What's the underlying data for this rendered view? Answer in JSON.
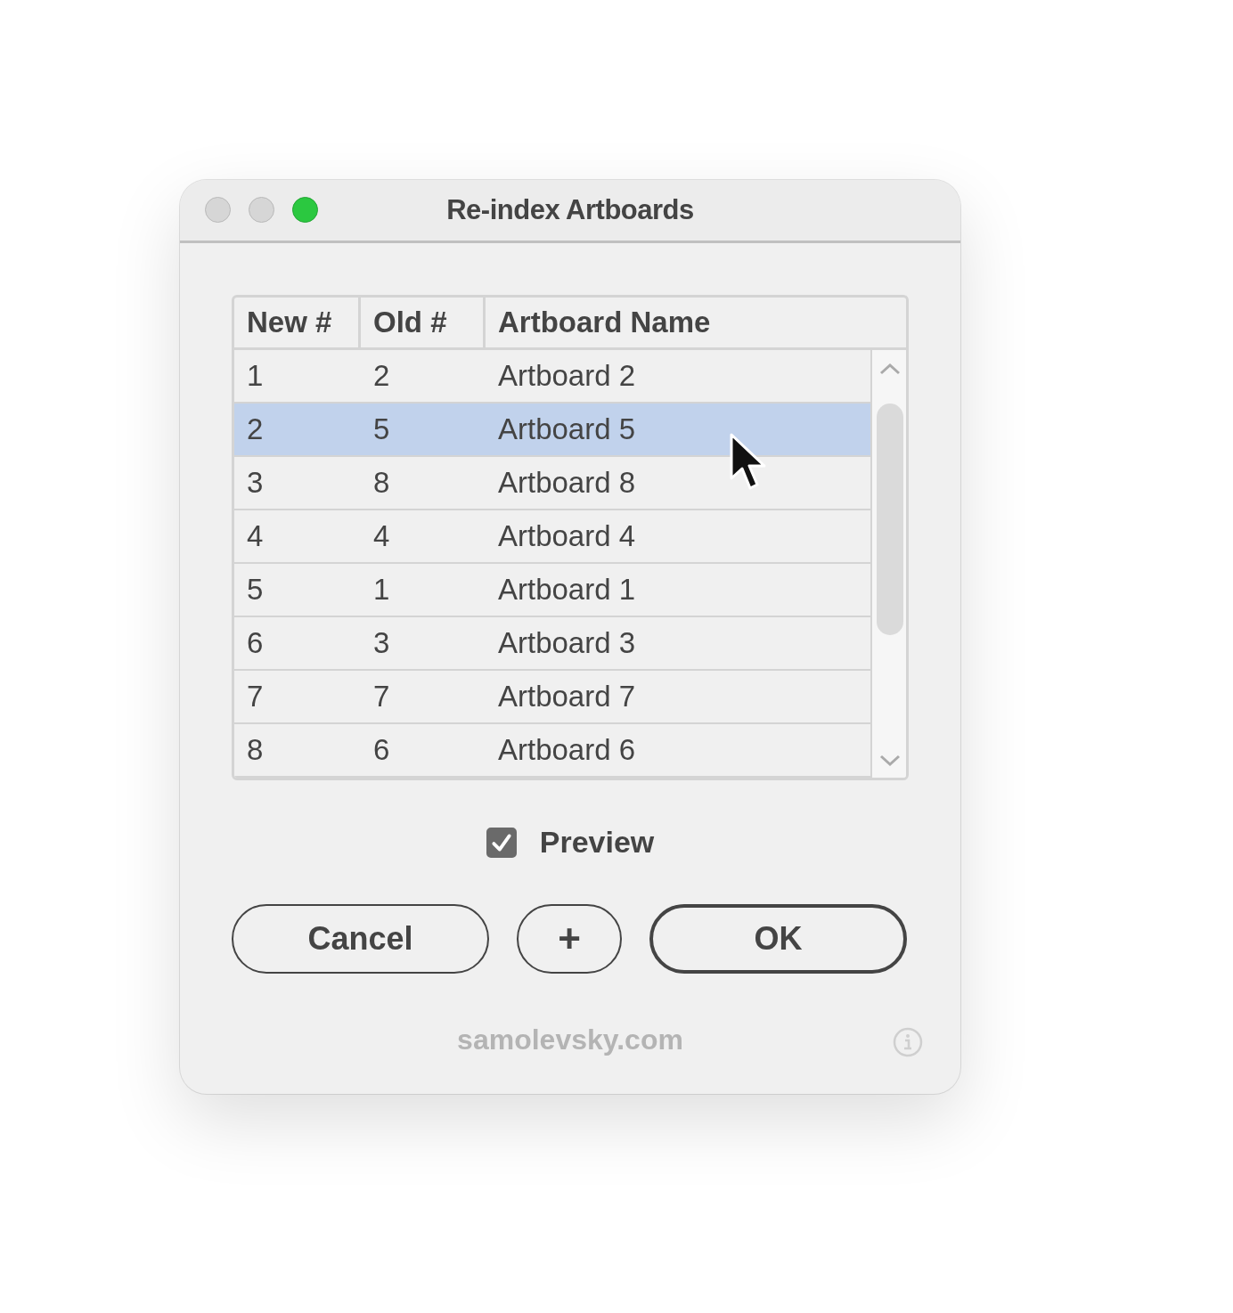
{
  "window": {
    "title": "Re-index Artboards"
  },
  "table": {
    "columns": [
      "New #",
      "Old #",
      "Artboard Name"
    ],
    "rows": [
      {
        "cells": [
          "1",
          "2",
          "Artboard 2"
        ],
        "selected": false
      },
      {
        "cells": [
          "2",
          "5",
          "Artboard 5"
        ],
        "selected": true
      },
      {
        "cells": [
          "3",
          "8",
          "Artboard 8"
        ],
        "selected": false
      },
      {
        "cells": [
          "4",
          "4",
          "Artboard 4"
        ],
        "selected": false
      },
      {
        "cells": [
          "5",
          "1",
          "Artboard 1"
        ],
        "selected": false
      },
      {
        "cells": [
          "6",
          "3",
          "Artboard 3"
        ],
        "selected": false
      },
      {
        "cells": [
          "7",
          "7",
          "Artboard 7"
        ],
        "selected": false
      },
      {
        "cells": [
          "8",
          "6",
          "Artboard 6"
        ],
        "selected": false
      }
    ]
  },
  "preview": {
    "label": "Preview",
    "checked": true
  },
  "buttons": [
    {
      "label": "Cancel",
      "kind": "normal"
    },
    {
      "label": "+",
      "kind": "icon"
    },
    {
      "label": "OK",
      "kind": "default"
    }
  ],
  "footer": {
    "link": "samolevsky.com"
  }
}
